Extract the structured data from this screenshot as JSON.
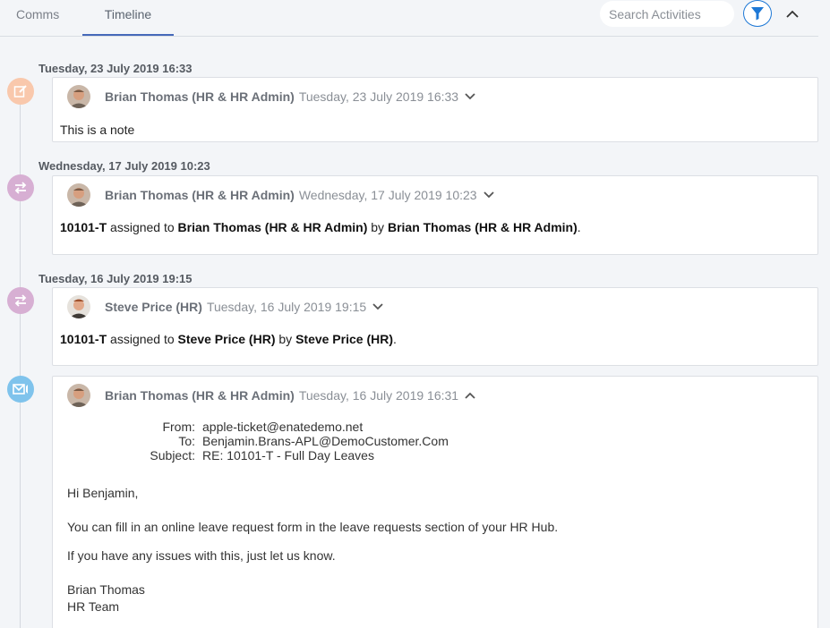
{
  "tabs": [
    {
      "label": "Comms",
      "active": false
    },
    {
      "label": "Timeline",
      "active": true
    }
  ],
  "search": {
    "placeholder": "Search Activities",
    "value": ""
  },
  "icons": {
    "filter": "filter-icon",
    "collapse": "chevron-up-icon"
  },
  "colors": {
    "accent": "#1e78d6",
    "note": "#f9c8ac",
    "assignment": "#d7afd3",
    "email": "#7fc3ec"
  },
  "entries": [
    {
      "date_header": "Tuesday, 23 July 2019 16:33",
      "type": "note",
      "author": "Brian Thomas (HR & HR Admin)",
      "timestamp": "Tuesday, 23 July 2019 16:33",
      "text": "This is a note"
    },
    {
      "date_header": "Wednesday, 17 July 2019 10:23",
      "type": "assignment",
      "author": "Brian Thomas (HR & HR Admin)",
      "timestamp": "Wednesday, 17 July 2019 10:23",
      "ticket": "10101-T",
      "assigned_word": "assigned to",
      "assignee": "Brian Thomas (HR & HR Admin)",
      "by_word": "by",
      "assigner": "Brian Thomas (HR & HR Admin)"
    },
    {
      "date_header": "Tuesday, 16 July 2019 19:15",
      "type": "assignment",
      "author": "Steve Price (HR)",
      "timestamp": "Tuesday, 16 July 2019 19:15",
      "ticket": "10101-T",
      "assigned_word": "assigned to",
      "assignee": "Steve Price (HR)",
      "by_word": "by",
      "assigner": "Steve Price (HR)"
    },
    {
      "type": "email",
      "author": "Brian Thomas (HR & HR Admin)",
      "timestamp": "Tuesday, 16 July 2019 16:31",
      "from_label": "From:",
      "from": "apple-ticket@enatedemo.net",
      "to_label": "To:",
      "to": "Benjamin.Brans-APL@DemoCustomer.Com",
      "subject_label": "Subject:",
      "subject": "RE: 10101-T - Full Day Leaves",
      "greeting": "Hi Benjamin,",
      "paragraph1": "You can fill in an online leave request form in the leave requests section of your HR Hub.",
      "paragraph2": "If you have any issues with this, just let us know.",
      "signature_name": "Brian Thomas",
      "signature_team": "HR Team"
    }
  ]
}
